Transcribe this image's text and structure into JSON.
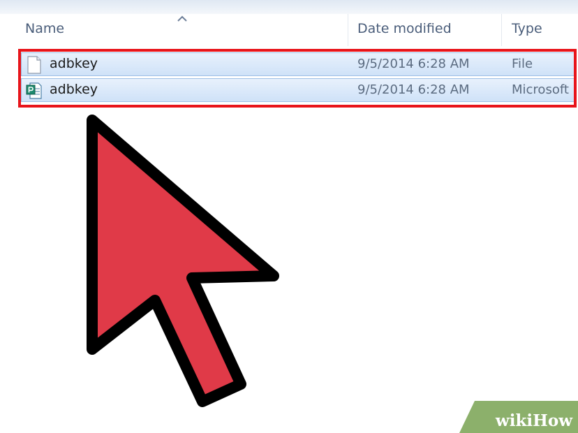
{
  "columns": {
    "name": "Name",
    "date_modified": "Date modified",
    "type": "Type"
  },
  "sort_indicator": "caret-up-icon",
  "files": [
    {
      "name": "adbkey",
      "date_modified": "9/5/2014 6:28 AM",
      "type": "File",
      "icon": "blank-file-icon"
    },
    {
      "name": "adbkey",
      "date_modified": "9/5/2014 6:28 AM",
      "type": "Microsoft",
      "icon": "publisher-file-icon"
    }
  ],
  "colors": {
    "highlight": "#e8141a",
    "pointer_fill": "#e03a48",
    "pointer_outline": "#000000",
    "selection": "#cfe2f8",
    "watermark_bg": "#8cb06b"
  },
  "watermark": {
    "text": "wikiHow"
  }
}
